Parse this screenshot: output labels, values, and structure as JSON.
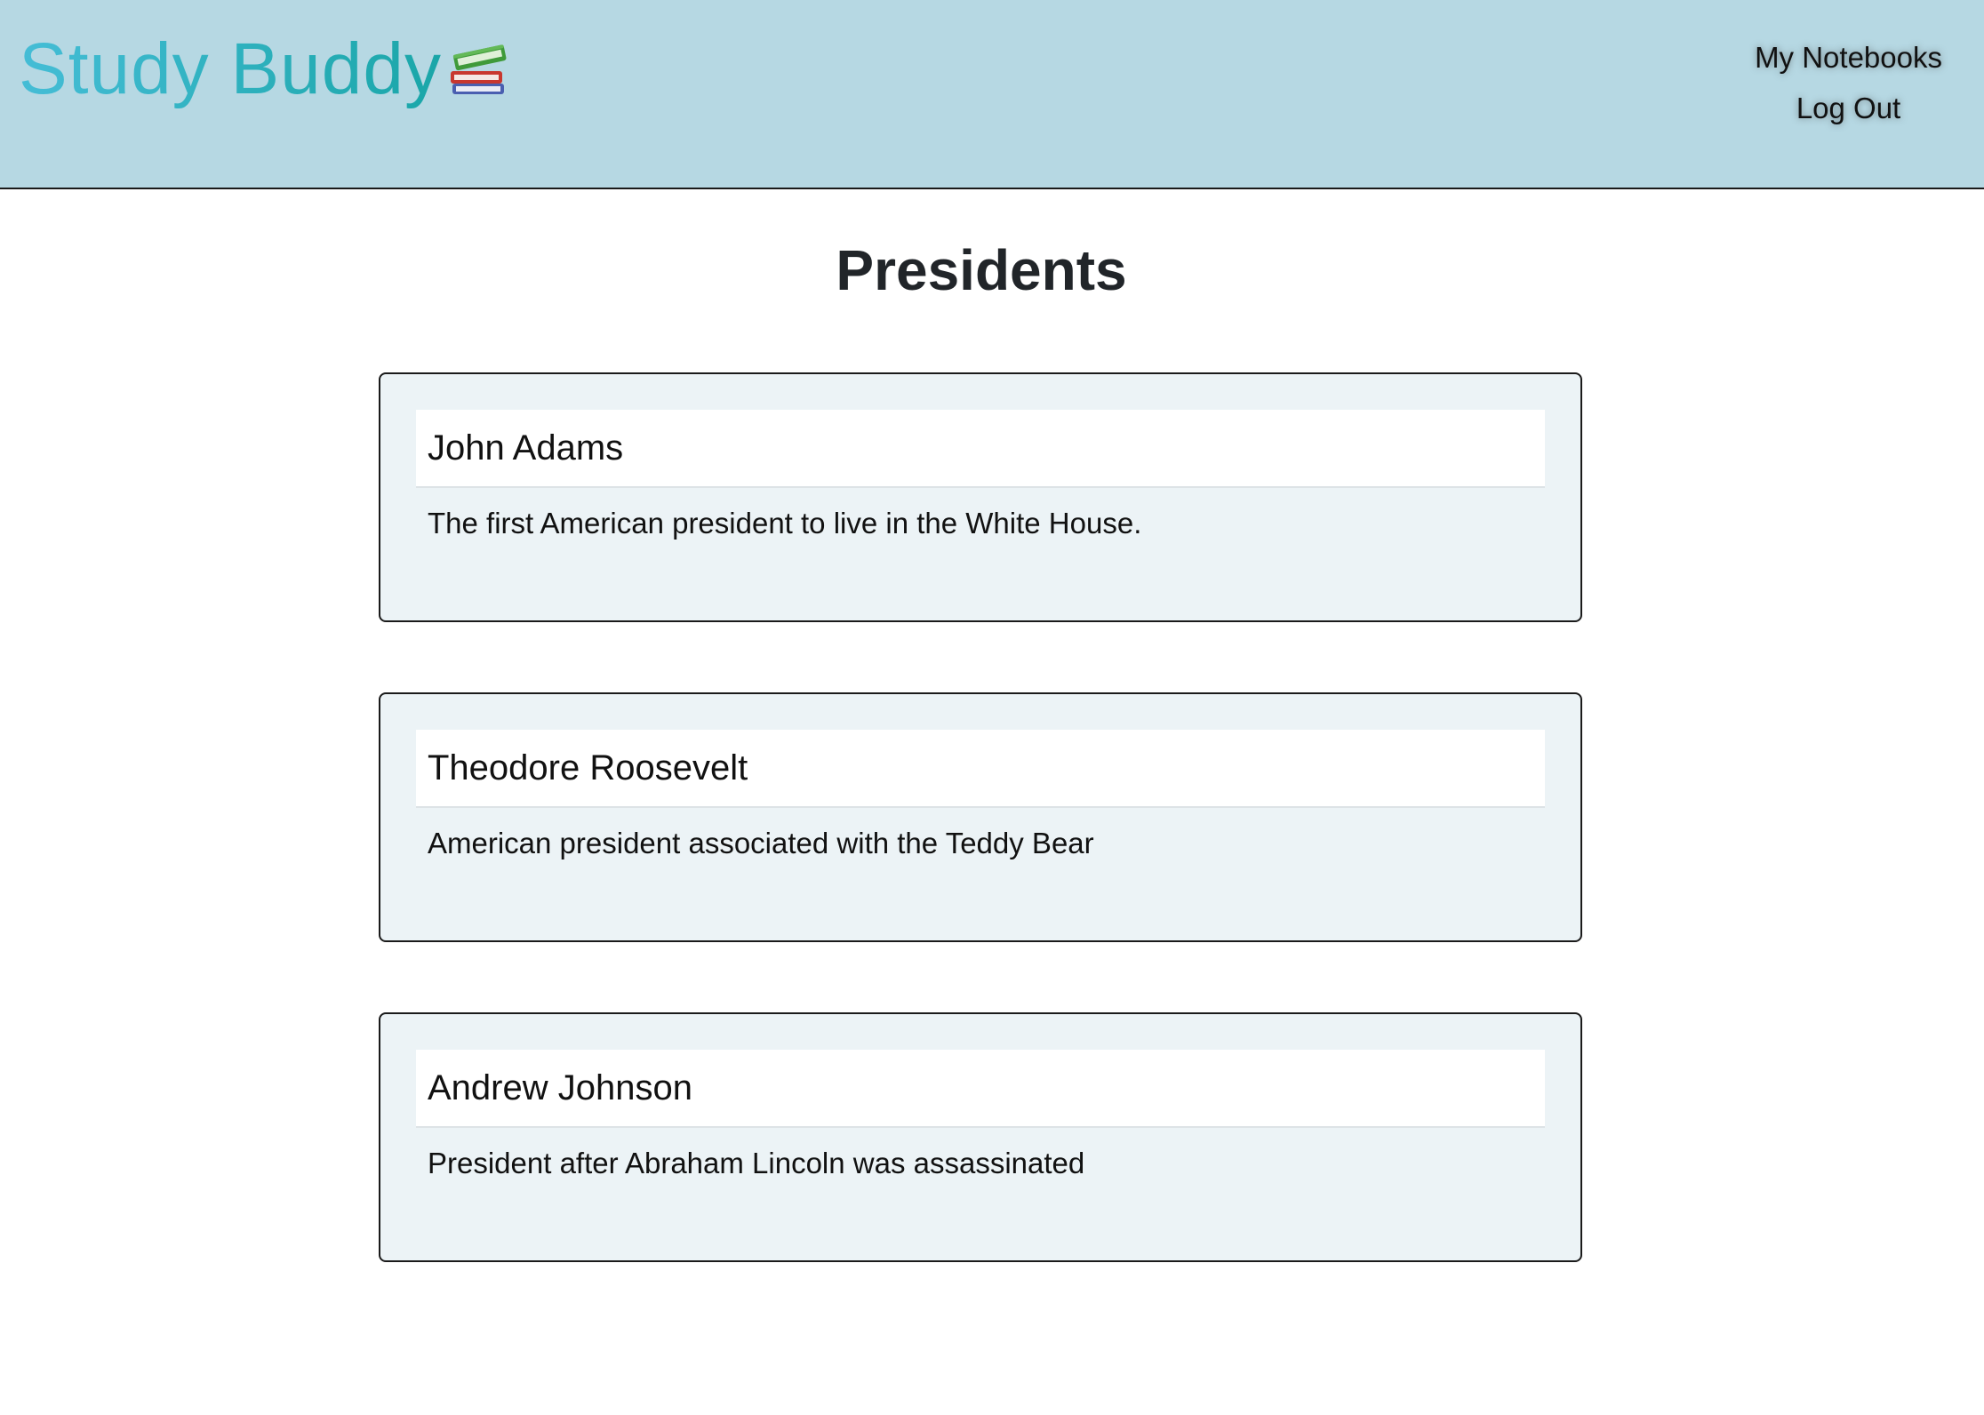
{
  "header": {
    "brand": "Study Buddy",
    "brand_icon": "books-icon",
    "nav": {
      "notebooks_label": "My Notebooks",
      "logout_label": "Log Out"
    },
    "colors": {
      "background": "#b6d8e3",
      "brand_gradient_start": "#45bdd6",
      "brand_gradient_end": "#1aa6a8"
    }
  },
  "page": {
    "title": "Presidents"
  },
  "cards": [
    {
      "term": "John Adams",
      "definition": "The first American president to live in the White House."
    },
    {
      "term": "Theodore Roosevelt",
      "definition": "American president associated with the Teddy Bear"
    },
    {
      "term": "Andrew Johnson",
      "definition": "President after Abraham Lincoln was assassinated"
    }
  ]
}
